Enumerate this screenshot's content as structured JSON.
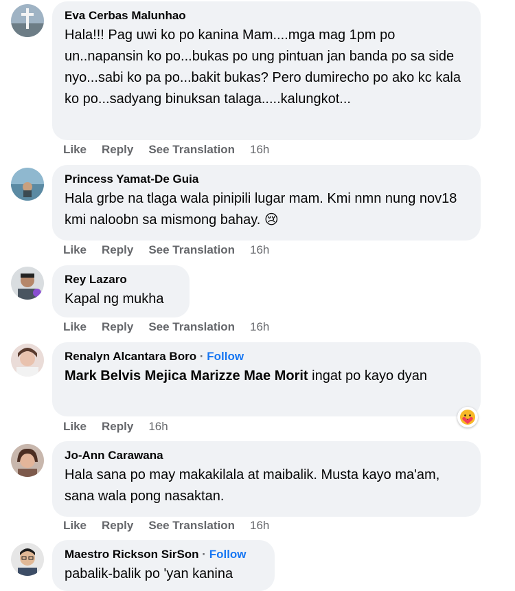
{
  "comments": [
    {
      "name": "Eva Cerbas Malunhao",
      "text": "Hala!!! Pag uwi ko po kanina Mam....mga mag 1pm po un..napansin ko po...bukas po ung pintuan jan banda po sa side nyo...sabi ko pa po...bakit bukas? Pero dumirecho po ako kc kala ko po...sadyang binuksan talaga.....kalungkot...",
      "actions": {
        "like": "Like",
        "reply": "Reply",
        "translate": "See Translation",
        "time": "16h"
      }
    },
    {
      "name": "Princess Yamat-De Guia",
      "text": "Hala grbe na tlaga wala pinipili lugar mam. Kmi nmn nung nov18 kmi naloobn sa mismong bahay. 😢",
      "actions": {
        "like": "Like",
        "reply": "Reply",
        "translate": "See Translation",
        "time": "16h"
      }
    },
    {
      "name": "Rey Lazaro",
      "text": "Kapal ng mukha",
      "actions": {
        "like": "Like",
        "reply": "Reply",
        "translate": "See Translation",
        "time": "16h"
      }
    },
    {
      "name": "Renalyn Alcantara Boro",
      "separator": "·",
      "follow": "Follow",
      "mention": "Mark Belvis Mejica Marizze Mae Morit",
      "text": " ingat po kayo dyan",
      "reaction": "care-emoji-icon",
      "actions": {
        "like": "Like",
        "reply": "Reply",
        "time": "16h"
      }
    },
    {
      "name": "Jo-Ann Carawana",
      "text": "Hala sana po may makakilala at maibalik. Musta kayo ma'am, sana wala pong nasaktan.",
      "actions": {
        "like": "Like",
        "reply": "Reply",
        "translate": "See Translation",
        "time": "16h"
      }
    },
    {
      "name": "Maestro Rickson SirSon",
      "separator": "·",
      "follow": "Follow",
      "text": "pabalik-balik po 'yan kanina"
    }
  ],
  "colors": {
    "bubble": "#f0f2f5",
    "link": "#1877f2",
    "meta": "#65676b"
  }
}
